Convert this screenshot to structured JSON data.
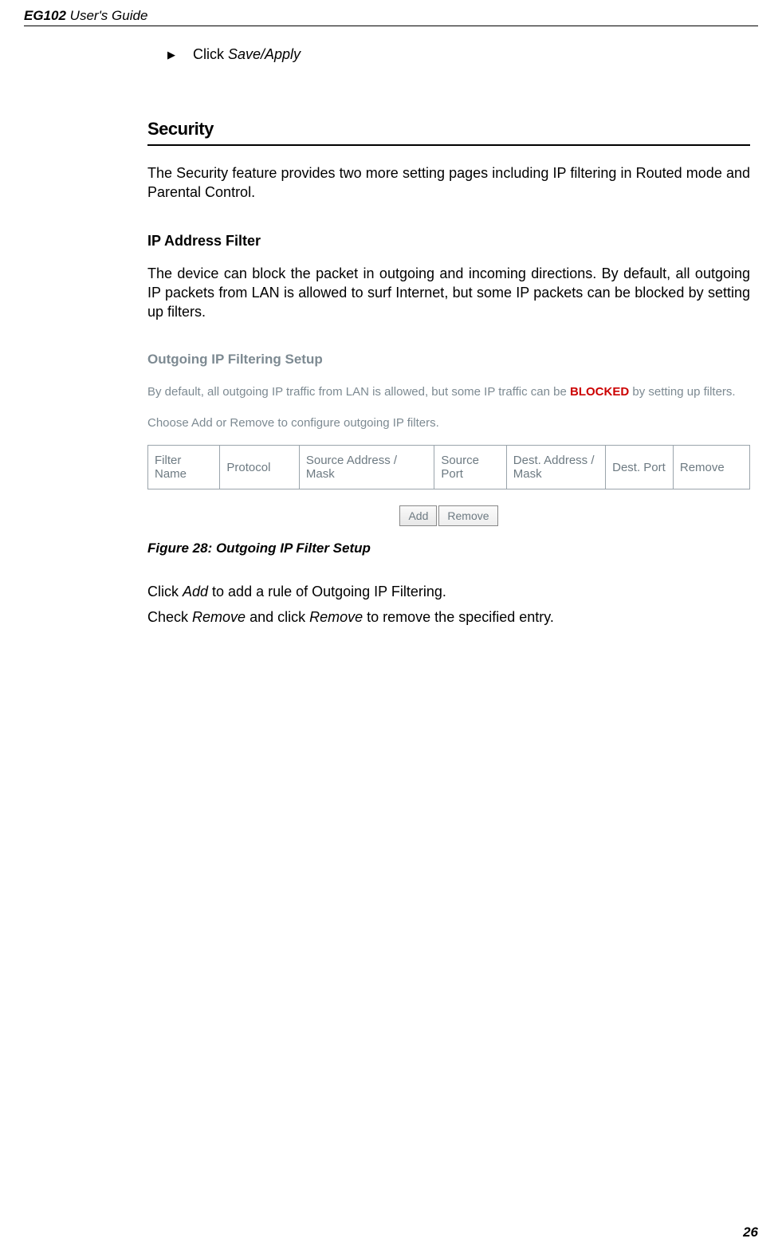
{
  "header": {
    "model": "EG102",
    "doc_label": "User's Guide"
  },
  "bullet": {
    "text_prefix": "Click ",
    "text_italic": "Save/Apply"
  },
  "section": {
    "title": "Security",
    "intro": "The Security feature provides two more setting pages including IP filtering in Routed mode and Parental Control."
  },
  "ipfilter": {
    "heading": "IP Address Filter",
    "desc": "The device can block the packet in outgoing and incoming directions. By default, all outgoing IP packets from LAN is allowed to surf Internet, but some IP packets can be blocked by setting up filters."
  },
  "figure": {
    "title": "Outgoing IP Filtering Setup",
    "desc_pre": "By default, all outgoing IP traffic from LAN is allowed, but some IP traffic can be ",
    "desc_blocked": "BLOCKED",
    "desc_post": " by setting up filters.",
    "desc_line2": "Choose Add or Remove to configure outgoing IP filters.",
    "headers": [
      "Filter Name",
      "Protocol",
      "Source Address / Mask",
      "Source Port",
      "Dest. Address / Mask",
      "Dest. Port",
      "Remove"
    ],
    "btn_add": "Add",
    "btn_remove": "Remove",
    "caption": "Figure 28: Outgoing IP Filter Setup"
  },
  "instructions": {
    "line1_pre": "Click ",
    "line1_italic": "Add",
    "line1_post": " to add a rule of Outgoing IP Filtering.",
    "line2_pre": "Check ",
    "line2_italic1": "Remove",
    "line2_mid": " and click ",
    "line2_italic2": "Remove",
    "line2_post": " to remove the specified entry."
  },
  "page_number": "26"
}
